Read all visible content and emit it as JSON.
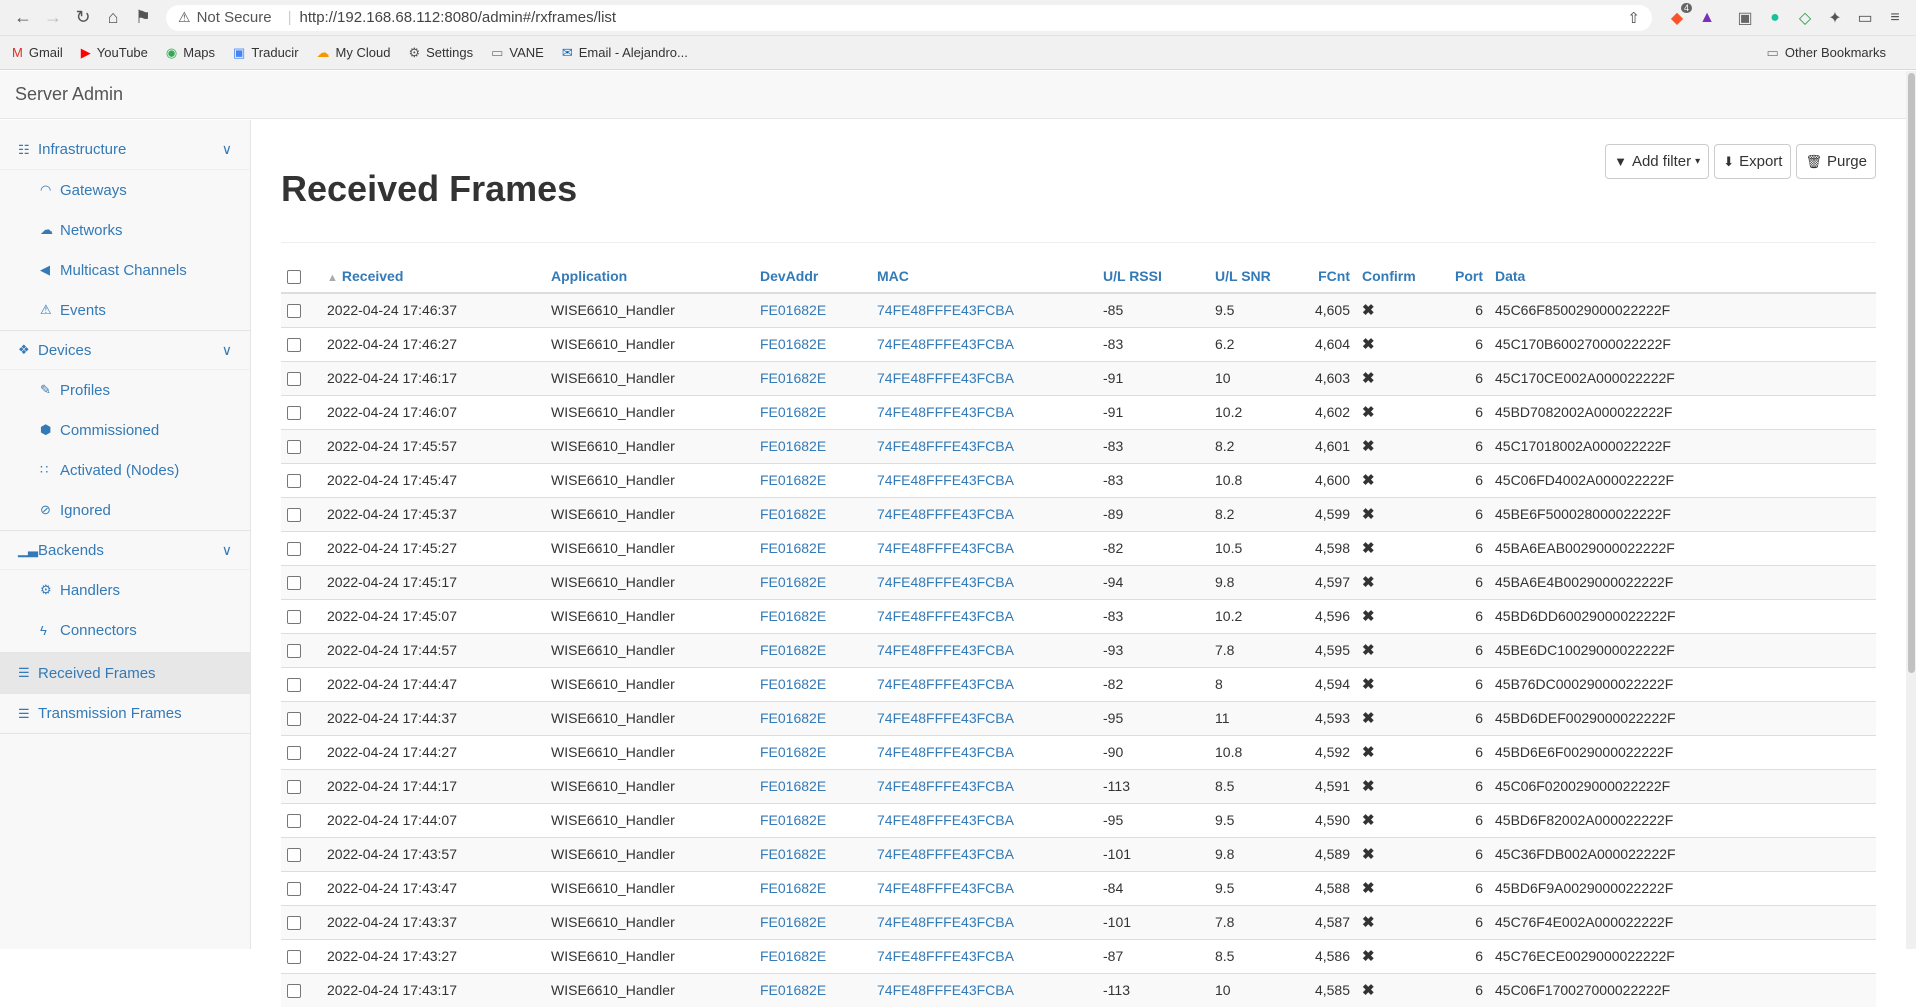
{
  "browser": {
    "security_label": "Not Secure",
    "url": "http://192.168.68.112:8080/admin#/rxframes/list",
    "ext_badge": "4",
    "bookmarks": [
      {
        "label": "Gmail",
        "icon": "M",
        "color": "#d93025"
      },
      {
        "label": "YouTube",
        "icon": "▶",
        "color": "#ff0000"
      },
      {
        "label": "Maps",
        "icon": "📍",
        "color": "#34a853"
      },
      {
        "label": "Traducir",
        "icon": "文",
        "color": "#4285f4"
      },
      {
        "label": "My Cloud",
        "icon": "☁",
        "color": "#f29900"
      },
      {
        "label": "Settings",
        "icon": "⚙",
        "color": "#555555"
      },
      {
        "label": "VANE",
        "icon": "▭",
        "color": "#777777"
      },
      {
        "label": "Email - Alejandro...",
        "icon": "✉",
        "color": "#0a66c2"
      }
    ],
    "other_bookmarks": "Other Bookmarks"
  },
  "app": {
    "title": "Server Admin"
  },
  "sidebar": {
    "infrastructure": "Infrastructure",
    "gateways": "Gateways",
    "networks": "Networks",
    "multicast": "Multicast Channels",
    "events": "Events",
    "devices": "Devices",
    "profiles": "Profiles",
    "commissioned": "Commissioned",
    "activated": "Activated (Nodes)",
    "ignored": "Ignored",
    "backends": "Backends",
    "handlers": "Handlers",
    "connectors": "Connectors",
    "received": "Received Frames",
    "transmission": "Transmission Frames"
  },
  "page": {
    "title": "Received Frames",
    "add_filter": "Add filter",
    "export": "Export",
    "purge": "Purge"
  },
  "table": {
    "headers": [
      "Received",
      "Application",
      "DevAddr",
      "MAC",
      "U/L RSSI",
      "U/L SNR",
      "FCnt",
      "Confirm",
      "Port",
      "Data"
    ],
    "rows": [
      [
        "2022-04-24 17:46:37",
        "WISE6610_Handler",
        "FE01682E",
        "74FE48FFFE43FCBA",
        "-85",
        "9.5",
        "4,605",
        "✖",
        "6",
        "45C66F850029000022222F"
      ],
      [
        "2022-04-24 17:46:27",
        "WISE6610_Handler",
        "FE01682E",
        "74FE48FFFE43FCBA",
        "-83",
        "6.2",
        "4,604",
        "✖",
        "6",
        "45C170B60027000022222F"
      ],
      [
        "2022-04-24 17:46:17",
        "WISE6610_Handler",
        "FE01682E",
        "74FE48FFFE43FCBA",
        "-91",
        "10",
        "4,603",
        "✖",
        "6",
        "45C170CE002A000022222F"
      ],
      [
        "2022-04-24 17:46:07",
        "WISE6610_Handler",
        "FE01682E",
        "74FE48FFFE43FCBA",
        "-91",
        "10.2",
        "4,602",
        "✖",
        "6",
        "45BD7082002A000022222F"
      ],
      [
        "2022-04-24 17:45:57",
        "WISE6610_Handler",
        "FE01682E",
        "74FE48FFFE43FCBA",
        "-83",
        "8.2",
        "4,601",
        "✖",
        "6",
        "45C17018002A000022222F"
      ],
      [
        "2022-04-24 17:45:47",
        "WISE6610_Handler",
        "FE01682E",
        "74FE48FFFE43FCBA",
        "-83",
        "10.8",
        "4,600",
        "✖",
        "6",
        "45C06FD4002A000022222F"
      ],
      [
        "2022-04-24 17:45:37",
        "WISE6610_Handler",
        "FE01682E",
        "74FE48FFFE43FCBA",
        "-89",
        "8.2",
        "4,599",
        "✖",
        "6",
        "45BE6F500028000022222F"
      ],
      [
        "2022-04-24 17:45:27",
        "WISE6610_Handler",
        "FE01682E",
        "74FE48FFFE43FCBA",
        "-82",
        "10.5",
        "4,598",
        "✖",
        "6",
        "45BA6EAB0029000022222F"
      ],
      [
        "2022-04-24 17:45:17",
        "WISE6610_Handler",
        "FE01682E",
        "74FE48FFFE43FCBA",
        "-94",
        "9.8",
        "4,597",
        "✖",
        "6",
        "45BA6E4B0029000022222F"
      ],
      [
        "2022-04-24 17:45:07",
        "WISE6610_Handler",
        "FE01682E",
        "74FE48FFFE43FCBA",
        "-83",
        "10.2",
        "4,596",
        "✖",
        "6",
        "45BD6DD60029000022222F"
      ],
      [
        "2022-04-24 17:44:57",
        "WISE6610_Handler",
        "FE01682E",
        "74FE48FFFE43FCBA",
        "-93",
        "7.8",
        "4,595",
        "✖",
        "6",
        "45BE6DC10029000022222F"
      ],
      [
        "2022-04-24 17:44:47",
        "WISE6610_Handler",
        "FE01682E",
        "74FE48FFFE43FCBA",
        "-82",
        "8",
        "4,594",
        "✖",
        "6",
        "45B76DC00029000022222F"
      ],
      [
        "2022-04-24 17:44:37",
        "WISE6610_Handler",
        "FE01682E",
        "74FE48FFFE43FCBA",
        "-95",
        "11",
        "4,593",
        "✖",
        "6",
        "45BD6DEF0029000022222F"
      ],
      [
        "2022-04-24 17:44:27",
        "WISE6610_Handler",
        "FE01682E",
        "74FE48FFFE43FCBA",
        "-90",
        "10.8",
        "4,592",
        "✖",
        "6",
        "45BD6E6F0029000022222F"
      ],
      [
        "2022-04-24 17:44:17",
        "WISE6610_Handler",
        "FE01682E",
        "74FE48FFFE43FCBA",
        "-113",
        "8.5",
        "4,591",
        "✖",
        "6",
        "45C06F020029000022222F"
      ],
      [
        "2022-04-24 17:44:07",
        "WISE6610_Handler",
        "FE01682E",
        "74FE48FFFE43FCBA",
        "-95",
        "9.5",
        "4,590",
        "✖",
        "6",
        "45BD6F82002A000022222F"
      ],
      [
        "2022-04-24 17:43:57",
        "WISE6610_Handler",
        "FE01682E",
        "74FE48FFFE43FCBA",
        "-101",
        "9.8",
        "4,589",
        "✖",
        "6",
        "45C36FDB002A000022222F"
      ],
      [
        "2022-04-24 17:43:47",
        "WISE6610_Handler",
        "FE01682E",
        "74FE48FFFE43FCBA",
        "-84",
        "9.5",
        "4,588",
        "✖",
        "6",
        "45BD6F9A0029000022222F"
      ],
      [
        "2022-04-24 17:43:37",
        "WISE6610_Handler",
        "FE01682E",
        "74FE48FFFE43FCBA",
        "-101",
        "7.8",
        "4,587",
        "✖",
        "6",
        "45C76F4E002A000022222F"
      ],
      [
        "2022-04-24 17:43:27",
        "WISE6610_Handler",
        "FE01682E",
        "74FE48FFFE43FCBA",
        "-87",
        "8.5",
        "4,586",
        "✖",
        "6",
        "45C76ECE0029000022222F"
      ],
      [
        "2022-04-24 17:43:17",
        "WISE6610_Handler",
        "FE01682E",
        "74FE48FFFE43FCBA",
        "-113",
        "10",
        "4,585",
        "✖",
        "6",
        "45C06F170027000022222F"
      ]
    ]
  }
}
